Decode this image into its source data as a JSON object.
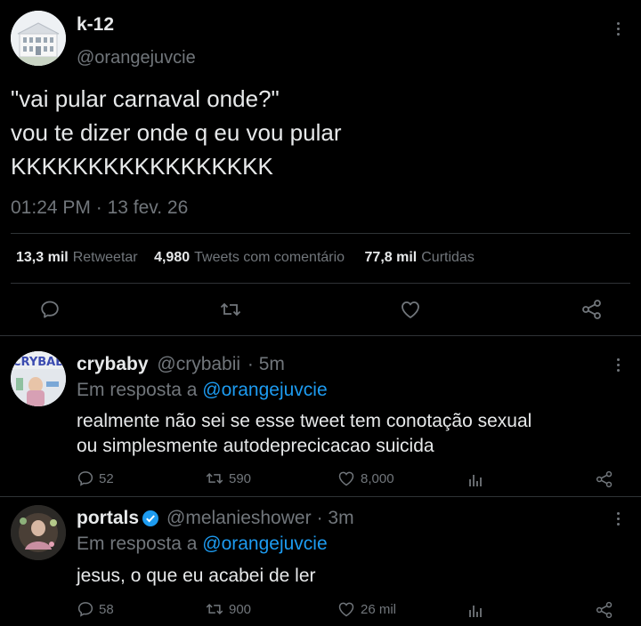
{
  "main_tweet": {
    "display_name": "k-12",
    "handle": "@orangejuvcie",
    "text_lines": [
      "\"vai pular carnaval onde?\"",
      "vou te dizer onde q eu vou pular",
      "KKKKKKKKKKKKKKKKK"
    ],
    "time": "01:24 PM",
    "separator": "·",
    "date": "13 fev. 26",
    "stats": {
      "retweets_count": "13,3 mil",
      "retweets_label": "Retweetar",
      "quotes_count": "4,980",
      "quotes_label": "Tweets com comentário",
      "likes_count": "77,8 mil",
      "likes_label": "Curtidas"
    }
  },
  "replies": [
    {
      "display_name": "crybaby",
      "handle": "@crybabii",
      "time": "· 5m",
      "in_reply_prefix": "Em resposta a",
      "in_reply_handle": "@orangejuvcie",
      "text_lines": [
        "realmente não sei se esse tweet tem conotação sexual",
        "ou simplesmente autodeprecicacao suicida"
      ],
      "reply_count": "52",
      "retweet_count": "590",
      "like_count": "8,000",
      "avatar_text": "CRYBAB"
    },
    {
      "display_name": "portals",
      "handle": "@melanieshower",
      "time": "· 3m",
      "in_reply_prefix": "Em resposta a",
      "in_reply_handle": "@orangejuvcie",
      "text_lines": [
        "jesus, o que eu acabei de ler"
      ],
      "reply_count": "58",
      "retweet_count": "900",
      "like_count": "26 mil",
      "verified": true
    }
  ],
  "colors": {
    "background": "#000000",
    "text": "#e7e9ea",
    "muted": "#71767b",
    "link": "#1d9bf0",
    "divider": "#2f3336"
  }
}
